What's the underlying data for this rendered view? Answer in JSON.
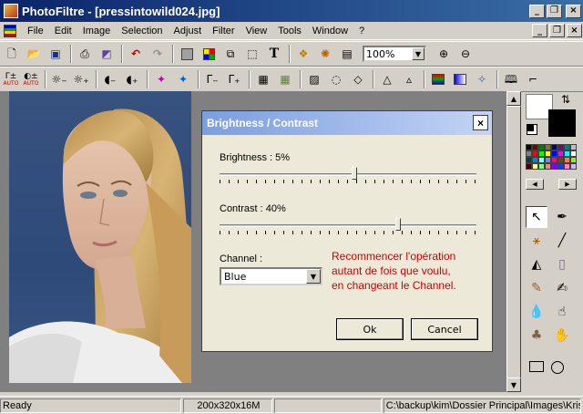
{
  "window": {
    "title": "PhotoFiltre - [pressintowild024.jpg]",
    "minimize": "_",
    "maximize": "❐",
    "close": "×"
  },
  "menu": [
    {
      "label": "File"
    },
    {
      "label": "Edit"
    },
    {
      "label": "Image"
    },
    {
      "label": "Selection"
    },
    {
      "label": "Adjust"
    },
    {
      "label": "Filter"
    },
    {
      "label": "View"
    },
    {
      "label": "Tools"
    },
    {
      "label": "Window"
    },
    {
      "label": "?"
    }
  ],
  "mdi": {
    "minimize": "_",
    "restore": "❐",
    "close": "×"
  },
  "toolbar": {
    "zoom": "100%"
  },
  "auto_label": "AUTO",
  "dialog": {
    "title": "Brightness / Contrast",
    "close": "×",
    "brightness_label": "Brightness : 5%",
    "brightness_value": 5,
    "contrast_label": "Contrast : 40%",
    "contrast_value": 40,
    "channel_label": "Channel :",
    "channel_value": "Blue",
    "note": "Recommencer l'opération\nautant de fois que voulu,\nen changeant le Channel.",
    "ok": "Ok",
    "cancel": "Cancel"
  },
  "colors": {
    "accent": "#0a246a",
    "note": "#d00000"
  },
  "status": {
    "state": "Ready",
    "size": "200x320x16M",
    "empty": "",
    "path": "C:\\backup\\kim\\Dossier Principal\\Images\\Kristen"
  }
}
